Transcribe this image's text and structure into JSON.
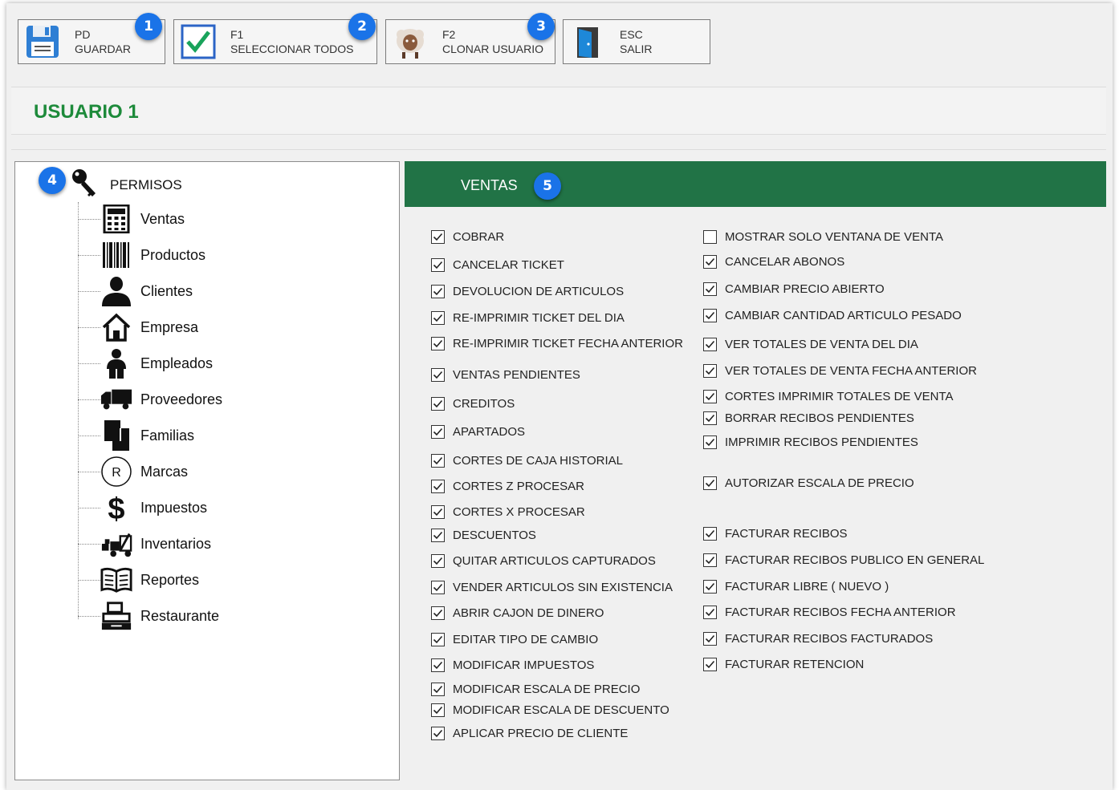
{
  "toolbar": {
    "buttons": [
      {
        "key": "PD",
        "label": "GUARDAR",
        "icon": "floppy-disk-icon",
        "badge": "1"
      },
      {
        "key": "F1",
        "label": "SELECCIONAR TODOS",
        "icon": "checkbox-check-icon",
        "badge": "2"
      },
      {
        "key": "F2",
        "label": "CLONAR USUARIO",
        "icon": "sheep-icon",
        "badge": "3"
      },
      {
        "key": "ESC",
        "label": "SALIR",
        "icon": "door-exit-icon",
        "badge": ""
      }
    ]
  },
  "user": {
    "title": "USUARIO 1"
  },
  "tree": {
    "root_label": "PERMISOS",
    "root_icon": "key-icon",
    "badge": "4",
    "items": [
      {
        "label": "Ventas",
        "icon": "calculator-icon"
      },
      {
        "label": "Productos",
        "icon": "barcode-icon"
      },
      {
        "label": "Clientes",
        "icon": "person-icon"
      },
      {
        "label": "Empresa",
        "icon": "house-icon"
      },
      {
        "label": "Empleados",
        "icon": "employee-icon"
      },
      {
        "label": "Proveedores",
        "icon": "truck-icon"
      },
      {
        "label": "Familias",
        "icon": "stacked-pages-icon"
      },
      {
        "label": "Marcas",
        "icon": "registered-mark-icon"
      },
      {
        "label": "Impuestos",
        "icon": "dollar-icon"
      },
      {
        "label": "Inventarios",
        "icon": "forklift-icon"
      },
      {
        "label": "Reportes",
        "icon": "book-icon"
      },
      {
        "label": "Restaurante",
        "icon": "cash-register-icon"
      }
    ]
  },
  "section": {
    "title": "VENTAS",
    "badge": "5"
  },
  "permissions_left": [
    {
      "label": "COBRAR",
      "checked": true
    },
    {
      "label": "CANCELAR TICKET",
      "checked": true
    },
    {
      "label": "DEVOLUCION DE ARTICULOS",
      "checked": true
    },
    {
      "label": "RE-IMPRIMIR TICKET DEL DIA",
      "checked": true
    },
    {
      "label": "RE-IMPRIMIR TICKET FECHA ANTERIOR",
      "checked": true
    },
    {
      "label": "VENTAS PENDIENTES",
      "checked": true
    },
    {
      "label": "CREDITOS",
      "checked": true
    },
    {
      "label": "APARTADOS",
      "checked": true
    },
    {
      "label": "CORTES DE CAJA HISTORIAL",
      "checked": true
    },
    {
      "label": "CORTES Z PROCESAR",
      "checked": true
    },
    {
      "label": "CORTES X PROCESAR",
      "checked": true
    },
    {
      "label": "DESCUENTOS",
      "checked": true
    },
    {
      "label": "QUITAR ARTICULOS CAPTURADOS",
      "checked": true
    },
    {
      "label": "VENDER ARTICULOS SIN EXISTENCIA",
      "checked": true
    },
    {
      "label": "ABRIR CAJON DE DINERO",
      "checked": true
    },
    {
      "label": "EDITAR TIPO DE CAMBIO",
      "checked": true
    },
    {
      "label": "MODIFICAR IMPUESTOS",
      "checked": true
    },
    {
      "label": "MODIFICAR ESCALA DE PRECIO",
      "checked": true
    },
    {
      "label": "MODIFICAR ESCALA DE DESCUENTO",
      "checked": true
    },
    {
      "label": "APLICAR PRECIO DE CLIENTE",
      "checked": true
    }
  ],
  "permissions_right": [
    {
      "label": "MOSTRAR SOLO VENTANA DE VENTA",
      "checked": false
    },
    {
      "label": "CANCELAR ABONOS",
      "checked": true
    },
    {
      "label": "CAMBIAR PRECIO ABIERTO",
      "checked": true
    },
    {
      "label": "CAMBIAR CANTIDAD ARTICULO PESADO",
      "checked": true
    },
    {
      "label": "VER TOTALES DE VENTA DEL DIA",
      "checked": true
    },
    {
      "label": "VER TOTALES DE VENTA FECHA ANTERIOR",
      "checked": true
    },
    {
      "label": "CORTES IMPRIMIR TOTALES DE VENTA",
      "checked": true
    },
    {
      "label": "BORRAR RECIBOS PENDIENTES",
      "checked": true
    },
    {
      "label": "IMPRIMIR RECIBOS PENDIENTES",
      "checked": true
    },
    {
      "label": "AUTORIZAR ESCALA DE PRECIO",
      "checked": true
    },
    {
      "label": "FACTURAR RECIBOS",
      "checked": true
    },
    {
      "label": "FACTURAR RECIBOS PUBLICO EN GENERAL",
      "checked": true
    },
    {
      "label": "FACTURAR LIBRE ( NUEVO )",
      "checked": true
    },
    {
      "label": "FACTURAR RECIBOS FECHA ANTERIOR",
      "checked": true
    },
    {
      "label": "FACTURAR RECIBOS FACTURADOS",
      "checked": true
    },
    {
      "label": "FACTURAR RETENCION",
      "checked": true
    }
  ],
  "colors": {
    "accent_green": "#217346",
    "title_green": "#1d8a3a",
    "badge_blue": "#1a73e8"
  }
}
